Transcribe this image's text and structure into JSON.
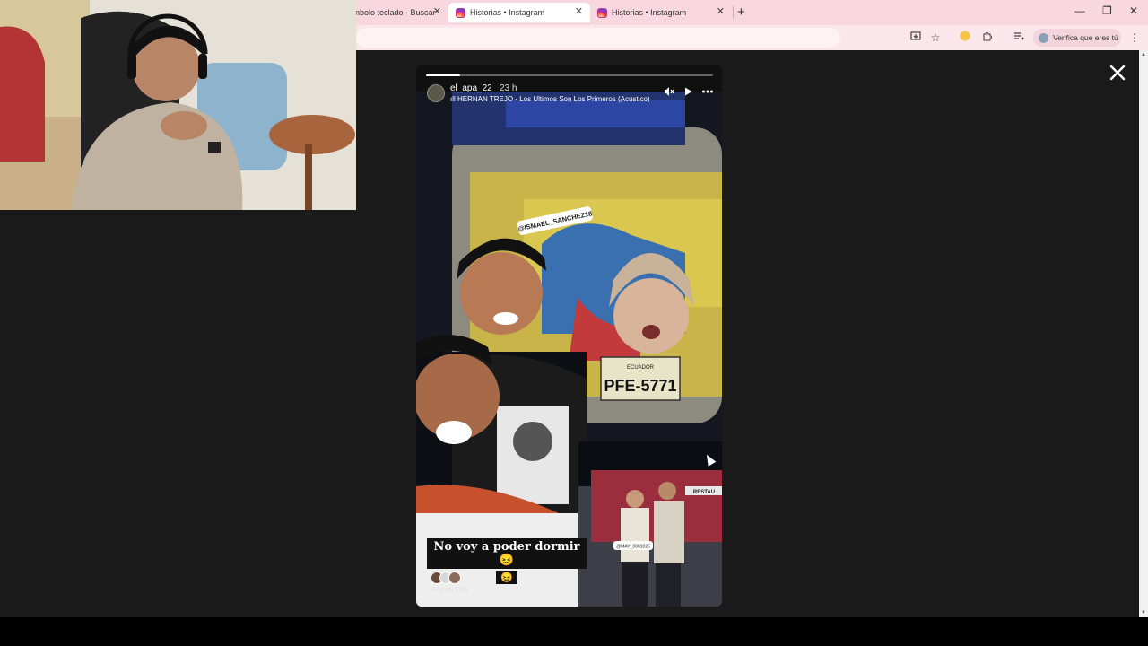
{
  "browser": {
    "tabs": [
      {
        "title": "nbolo teclado - Buscar",
        "active": false
      },
      {
        "title": "Historias • Instagram",
        "active": true
      },
      {
        "title": "Historias • Instagram",
        "active": false
      }
    ],
    "new_tab": "+",
    "window_controls": {
      "minimize": "—",
      "restore": "❐",
      "close": "✕"
    },
    "verify_label": "Verifica que eres tú",
    "accent": "#f9d7e0"
  },
  "story": {
    "username": "el_apa_22",
    "time": "23 h",
    "music": "HERNAN TREJO · Los Ultimos Son Los Primeros (Acustico)",
    "progress": 0.12,
    "controls": {
      "mute": "mute-icon",
      "play": "play-icon",
      "more": "more-icon"
    },
    "sticker_tag": "@ISMAEL_SANCHEZ18",
    "plate": "PFE-5771",
    "plate_country": "ECUADOR",
    "inset_tag": "@MAY_0001025",
    "inset_sign": "RESTAU",
    "caption_line1": "No voy a poder dormir😖",
    "caption_line2": "😖",
    "viewed_by": "Vista por 5135"
  },
  "viewer": {
    "close_icon": "close-icon",
    "background": "#1a1a1a"
  }
}
